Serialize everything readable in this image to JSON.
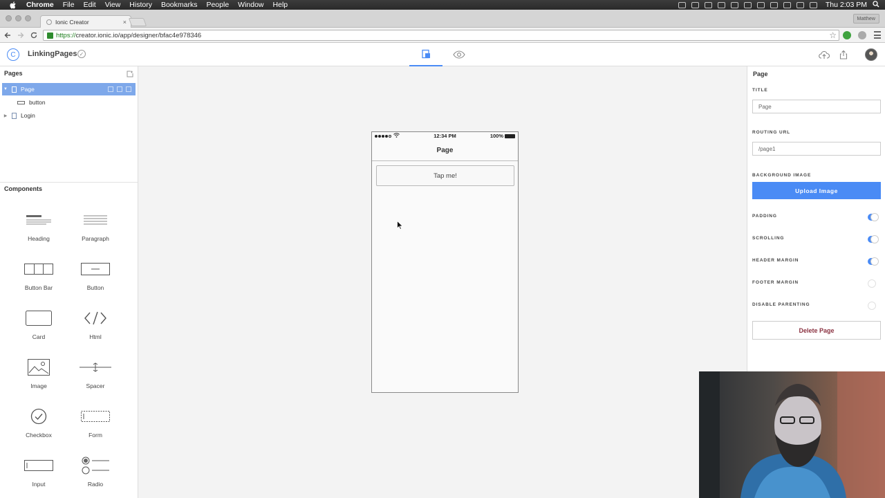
{
  "os_menubar": {
    "app": "Chrome",
    "items": [
      "File",
      "Edit",
      "View",
      "History",
      "Bookmarks",
      "People",
      "Window",
      "Help"
    ],
    "clock": "Thu 2:03 PM"
  },
  "browser": {
    "tab_title": "Ionic Creator",
    "profile": "Matthew",
    "url_scheme": "https://",
    "url_rest": "creator.ionic.io/app/designer/bfac4e978346"
  },
  "app_header": {
    "project_name": "LinkingPages"
  },
  "pages_panel": {
    "title": "Pages",
    "tree": [
      {
        "label": "Page",
        "selected": true
      },
      {
        "label": "button",
        "child": true
      },
      {
        "label": "Login"
      }
    ]
  },
  "components_panel": {
    "title": "Components",
    "items": [
      {
        "label": "Heading",
        "icon": "heading-icon"
      },
      {
        "label": "Paragraph",
        "icon": "paragraph-icon"
      },
      {
        "label": "Button Bar",
        "icon": "button-bar-icon"
      },
      {
        "label": "Button",
        "icon": "button-icon"
      },
      {
        "label": "Card",
        "icon": "card-icon"
      },
      {
        "label": "Html",
        "icon": "code-icon"
      },
      {
        "label": "Image",
        "icon": "image-icon"
      },
      {
        "label": "Spacer",
        "icon": "spacer-icon"
      },
      {
        "label": "Checkbox",
        "icon": "checkbox-icon"
      },
      {
        "label": "Form",
        "icon": "form-icon"
      },
      {
        "label": "Input",
        "icon": "input-icon"
      },
      {
        "label": "Radio",
        "icon": "radio-icon"
      }
    ]
  },
  "phone": {
    "time": "12:34 PM",
    "battery": "100%",
    "nav_title": "Page",
    "button_label": "Tap me!"
  },
  "properties": {
    "title": "Page",
    "title_label": "TITLE",
    "title_value": "Page",
    "routing_label": "ROUTING URL",
    "routing_value": "/page1",
    "bg_label": "BACKGROUND IMAGE",
    "upload_label": "Upload Image",
    "toggles": [
      {
        "label": "PADDING",
        "on": true
      },
      {
        "label": "SCROLLING",
        "on": true
      },
      {
        "label": "HEADER MARGIN",
        "on": true
      },
      {
        "label": "FOOTER MARGIN",
        "on": false
      },
      {
        "label": "DISABLE PARENTING",
        "on": false
      }
    ],
    "delete_label": "Delete Page"
  },
  "colors": {
    "accent": "#4a8bf5",
    "selected_row": "#7ea8ea",
    "delete_text": "#8a3140"
  }
}
